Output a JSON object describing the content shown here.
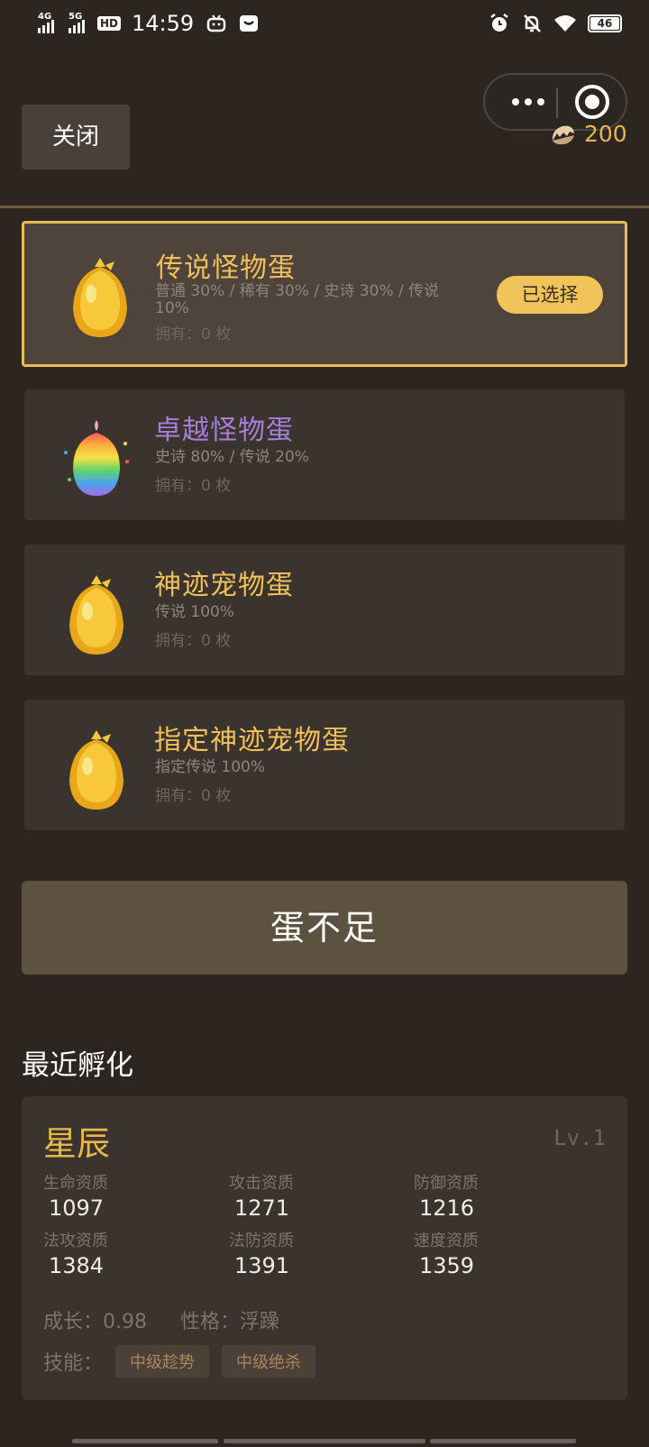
{
  "status_bar": {
    "net1": "4G",
    "net2": "5G",
    "hd": "HD",
    "time": "14:59",
    "battery": "46"
  },
  "header": {
    "close_label": "关闭",
    "currency_amount": "200",
    "currency_icon": "egg-shell-icon"
  },
  "eggs": [
    {
      "name": "传说怪物蛋",
      "rates": "普通 30% / 稀有 30% / 史诗 30% / 传说 10%",
      "owned": "拥有：0 枚",
      "name_color": "#f0c15a",
      "icon": "golden-egg-icon",
      "selected": true,
      "select_label": "已选择"
    },
    {
      "name": "卓越怪物蛋",
      "rates": "史诗 80% / 传说 20%",
      "owned": "拥有：0 枚",
      "name_color": "#a77fd6",
      "icon": "rainbow-egg-icon",
      "selected": false
    },
    {
      "name": "神迹宠物蛋",
      "rates": "传说 100%",
      "owned": "拥有：0 枚",
      "name_color": "#f0c15a",
      "icon": "golden-egg-icon",
      "selected": false
    },
    {
      "name": "指定神迹宠物蛋",
      "rates": "指定传说 100%",
      "owned": "拥有：0 枚",
      "name_color": "#f0c15a",
      "icon": "golden-egg-icon",
      "selected": false
    }
  ],
  "hatch_button": "蛋不足",
  "recent": {
    "title": "最近孵化",
    "pet": {
      "name": "星辰",
      "level": "Lv.1",
      "stats": [
        {
          "label": "生命资质",
          "value": "1097"
        },
        {
          "label": "攻击资质",
          "value": "1271"
        },
        {
          "label": "防御资质",
          "value": "1216"
        },
        {
          "label": "法攻资质",
          "value": "1384"
        },
        {
          "label": "法防资质",
          "value": "1391"
        },
        {
          "label": "速度资质",
          "value": "1359"
        }
      ],
      "growth": "成长：0.98",
      "personality": "性格：浮躁",
      "skills_label": "技能：",
      "skills": [
        "中级趁势",
        "中级绝杀"
      ]
    }
  },
  "colors": {
    "background": "#2c2520",
    "accent_gold": "#e8b94a",
    "selected_border": "#e9bd55",
    "card": "#3a332e",
    "epic_purple": "#a77fd6"
  }
}
